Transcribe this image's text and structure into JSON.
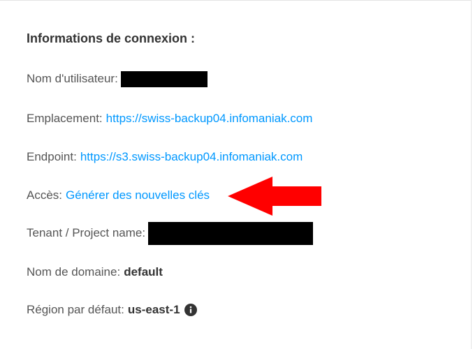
{
  "section": {
    "title": "Informations de connexion :"
  },
  "fields": {
    "username": {
      "label": "Nom d'utilisateur:"
    },
    "location": {
      "label": "Emplacement:",
      "value": "https://swiss-backup04.infomaniak.com"
    },
    "endpoint": {
      "label": "Endpoint:",
      "value": "https://s3.swiss-backup04.infomaniak.com"
    },
    "access": {
      "label": "Accès:",
      "link_text": "Générer des nouvelles clés"
    },
    "tenant": {
      "label": "Tenant / Project name:"
    },
    "domain": {
      "label": "Nom de domaine:",
      "value": "default"
    },
    "region": {
      "label": "Région par défaut:",
      "value": "us-east-1"
    }
  },
  "icons": {
    "region_info": "info-circle-icon",
    "annotation": "red-arrow-left-icon"
  },
  "colors": {
    "link": "#0098ff",
    "annotation_arrow": "#ff0000",
    "redaction": "#000000"
  }
}
